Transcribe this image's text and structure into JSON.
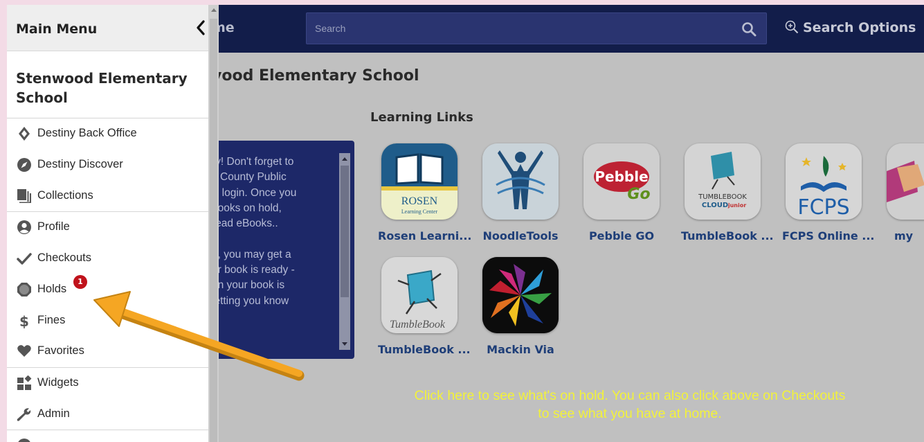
{
  "topbar": {
    "brand_fragment": "me",
    "search_placeholder": "Search",
    "search_options_label": "Search Options"
  },
  "main": {
    "school_heading_fragment": "vood Elementary School",
    "learning_links_title": "Learning Links",
    "message_text": "ry! Don't forget to\nx County Public\nS login.  Once you\nbooks on hold,\nread eBooks..\n\nd, you may get a\nur book is ready -\nen your book is\nletting you know",
    "links": [
      {
        "label": "Rosen Learni..."
      },
      {
        "label": "NoodleTools"
      },
      {
        "label": "Pebble GO"
      },
      {
        "label": "TumbleBook ..."
      },
      {
        "label": "FCPS Online ..."
      },
      {
        "label": "my"
      },
      {
        "label": "TumbleBook ..."
      },
      {
        "label": "Mackin Via"
      }
    ],
    "tile_texts": {
      "rosen_line1": "ROSEN",
      "rosen_line2": "Learning Center",
      "pebble_line1": "Pebble",
      "pebble_line2": "Go",
      "tumble_cloud_line1": "TUMBLEBOOK",
      "tumble_cloud_line2": "CLOUD",
      "tumble_cloud_line3": "junior",
      "fcps": "FCPS",
      "tumble_book": "TumbleBook"
    }
  },
  "menu": {
    "title": "Main Menu",
    "school": "Stenwood Elementary School",
    "items": [
      {
        "label": "Destiny Back Office",
        "icon": "destiny-icon"
      },
      {
        "label": "Destiny Discover",
        "icon": "compass-icon"
      },
      {
        "label": "Collections",
        "icon": "collections-icon"
      },
      {
        "label": "Profile",
        "icon": "user-circle-icon"
      },
      {
        "label": "Checkouts",
        "icon": "checkmark-icon"
      },
      {
        "label": "Holds",
        "icon": "octagon-icon"
      },
      {
        "label": "Fines",
        "icon": "dollar-icon"
      },
      {
        "label": "Favorites",
        "icon": "heart-icon"
      },
      {
        "label": "Widgets",
        "icon": "widgets-icon"
      },
      {
        "label": "Admin",
        "icon": "wrench-icon"
      }
    ],
    "holds_badge": "1"
  },
  "annotation": {
    "caption": "Click here to see what's on hold.  You can also click above on Checkouts\nto see what you have at home.",
    "arrow_color": "#f5a623",
    "caption_color": "#f2f23a"
  }
}
